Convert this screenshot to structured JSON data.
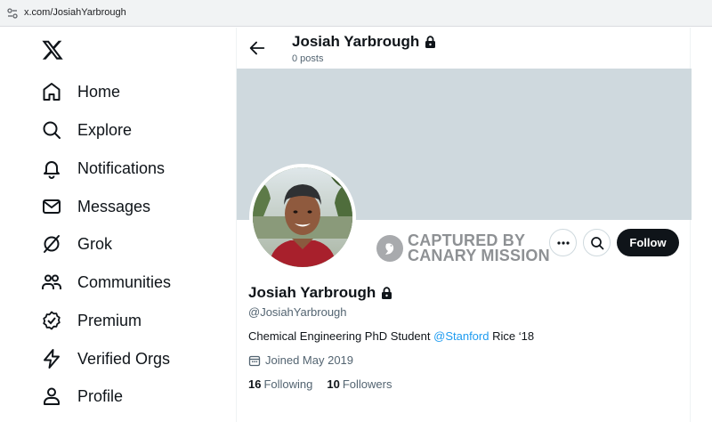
{
  "browser": {
    "url": "x.com/JosiahYarbrough"
  },
  "sidebar": {
    "items": [
      {
        "label": "Home",
        "icon": "home-icon"
      },
      {
        "label": "Explore",
        "icon": "search-icon"
      },
      {
        "label": "Notifications",
        "icon": "bell-icon"
      },
      {
        "label": "Messages",
        "icon": "envelope-icon"
      },
      {
        "label": "Grok",
        "icon": "grok-icon"
      },
      {
        "label": "Communities",
        "icon": "people-icon"
      },
      {
        "label": "Premium",
        "icon": "verified-badge-icon"
      },
      {
        "label": "Verified Orgs",
        "icon": "lightning-icon"
      },
      {
        "label": "Profile",
        "icon": "person-icon"
      }
    ]
  },
  "header": {
    "name": "Josiah Yarbrough",
    "posts": "0 posts"
  },
  "watermark": {
    "line1": "CAPTURED BY",
    "line2": "CANARY MISSION"
  },
  "actions": {
    "follow_label": "Follow"
  },
  "profile": {
    "name": "Josiah Yarbrough",
    "handle": "@JosiahYarbrough",
    "bio_before": "Chemical Engineering PhD Student ",
    "bio_mention": "@Stanford",
    "bio_after": " Rice ‘18",
    "joined": "Joined May 2019",
    "following_count": "16",
    "following_label": "Following",
    "followers_count": "10",
    "followers_label": "Followers"
  },
  "colors": {
    "accent": "#1d9bf0",
    "banner": "#cfd9de",
    "text": "#0f1419",
    "muted": "#536471"
  }
}
